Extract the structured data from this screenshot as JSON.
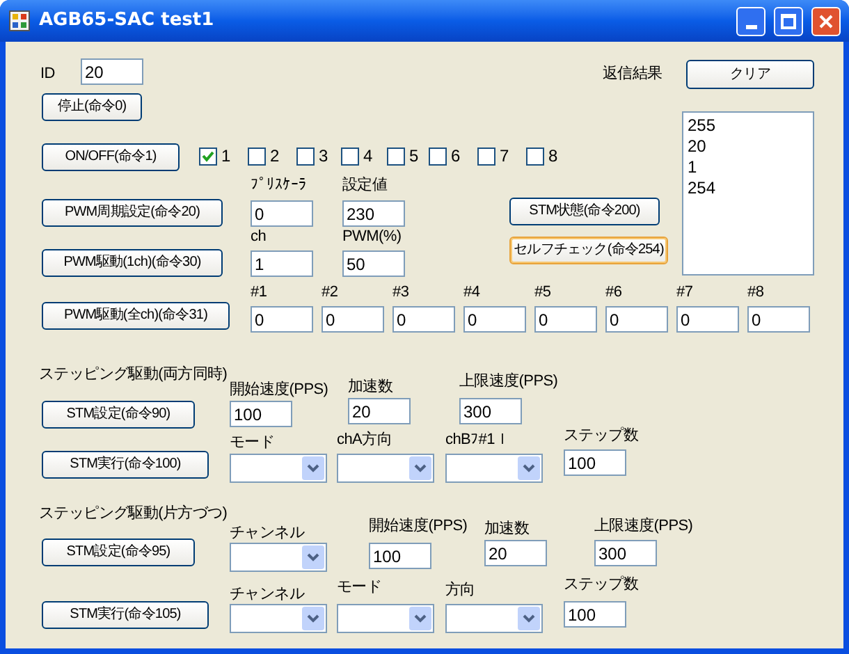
{
  "window": {
    "title": "AGB65-SAC test1"
  },
  "controls": [
    {
      "kind": "label",
      "text": "ID"
    },
    {
      "kind": "input",
      "value": "20"
    },
    {
      "kind": "label",
      "text": "返信結果"
    },
    {
      "kind": "button",
      "text": "クリア",
      "focused": false
    },
    {
      "kind": "button",
      "text": "停止(命令0)",
      "focused": false
    },
    {
      "kind": "button",
      "text": "ON/OFF(命令1)",
      "focused": false
    },
    {
      "kind": "checkbox",
      "text": "1",
      "checked": true
    },
    {
      "kind": "checkbox",
      "text": "2",
      "checked": false
    },
    {
      "kind": "checkbox",
      "text": "3",
      "checked": false
    },
    {
      "kind": "checkbox",
      "text": "4",
      "checked": false
    },
    {
      "kind": "checkbox",
      "text": "5",
      "checked": false
    },
    {
      "kind": "checkbox",
      "text": "6",
      "checked": false
    },
    {
      "kind": "checkbox",
      "text": "7",
      "checked": false
    },
    {
      "kind": "checkbox",
      "text": "8",
      "checked": false
    },
    {
      "kind": "label",
      "text": "ﾌﾟﾘｽｹｰﾗ"
    },
    {
      "kind": "label",
      "text": "設定値"
    },
    {
      "kind": "button",
      "text": "PWM周期設定(命令20)",
      "focused": false
    },
    {
      "kind": "input",
      "value": "0"
    },
    {
      "kind": "input",
      "value": "230"
    },
    {
      "kind": "button",
      "text": "STM状態(命令200)",
      "focused": false
    },
    {
      "kind": "label",
      "text": "ch"
    },
    {
      "kind": "label",
      "text": "PWM(%)"
    },
    {
      "kind": "button",
      "text": "セルフチェック(命令254)",
      "focused": true
    },
    {
      "kind": "button",
      "text": "PWM駆動(1ch)(命令30)",
      "focused": false
    },
    {
      "kind": "input",
      "value": "1"
    },
    {
      "kind": "input",
      "value": "50"
    },
    {
      "kind": "listbox",
      "items": [
        "255",
        "20",
        "1",
        "254"
      ]
    },
    {
      "kind": "label",
      "text": "#1"
    },
    {
      "kind": "label",
      "text": "#2"
    },
    {
      "kind": "label",
      "text": "#3"
    },
    {
      "kind": "label",
      "text": "#4"
    },
    {
      "kind": "label",
      "text": "#5"
    },
    {
      "kind": "label",
      "text": "#6"
    },
    {
      "kind": "label",
      "text": "#7"
    },
    {
      "kind": "label",
      "text": "#8"
    },
    {
      "kind": "button",
      "text": "PWM駆動(全ch)(命令31)",
      "focused": false
    },
    {
      "kind": "input",
      "value": "0"
    },
    {
      "kind": "input",
      "value": "0"
    },
    {
      "kind": "input",
      "value": "0"
    },
    {
      "kind": "input",
      "value": "0"
    },
    {
      "kind": "input",
      "value": "0"
    },
    {
      "kind": "input",
      "value": "0"
    },
    {
      "kind": "input",
      "value": "0"
    },
    {
      "kind": "input",
      "value": "0"
    },
    {
      "kind": "label",
      "text": "ステッピング駆動(両方同時)"
    },
    {
      "kind": "label",
      "text": "開始速度(PPS)"
    },
    {
      "kind": "label",
      "text": "加速数"
    },
    {
      "kind": "label",
      "text": "上限速度(PPS)"
    },
    {
      "kind": "button",
      "text": "STM設定(命令90)",
      "focused": false
    },
    {
      "kind": "input",
      "value": "100"
    },
    {
      "kind": "input",
      "value": "20"
    },
    {
      "kind": "input",
      "value": "300"
    },
    {
      "kind": "label",
      "text": "モード"
    },
    {
      "kind": "label",
      "text": "chA方向"
    },
    {
      "kind": "label",
      "text": "chBﾌ#1ｌ"
    },
    {
      "kind": "label",
      "text": "ステップ数"
    },
    {
      "kind": "button",
      "text": "STM実行(命令100)",
      "focused": false
    },
    {
      "kind": "combo"
    },
    {
      "kind": "combo"
    },
    {
      "kind": "combo"
    },
    {
      "kind": "input",
      "value": "100"
    },
    {
      "kind": "label",
      "text": "ステッピング駆動(片方づつ)"
    },
    {
      "kind": "label",
      "text": "チャンネル"
    },
    {
      "kind": "label",
      "text": "開始速度(PPS)"
    },
    {
      "kind": "label",
      "text": "加速数"
    },
    {
      "kind": "label",
      "text": "上限速度(PPS)"
    },
    {
      "kind": "button",
      "text": "STM設定(命令95)",
      "focused": false
    },
    {
      "kind": "combo"
    },
    {
      "kind": "input",
      "value": "100"
    },
    {
      "kind": "input",
      "value": "20"
    },
    {
      "kind": "input",
      "value": "300"
    },
    {
      "kind": "label",
      "text": "チャンネル"
    },
    {
      "kind": "label",
      "text": "モード"
    },
    {
      "kind": "label",
      "text": "方向"
    },
    {
      "kind": "label",
      "text": "ステップ数"
    },
    {
      "kind": "button",
      "text": "STM実行(命令105)",
      "focused": false
    },
    {
      "kind": "combo"
    },
    {
      "kind": "combo"
    },
    {
      "kind": "combo"
    },
    {
      "kind": "input",
      "value": "100"
    }
  ]
}
